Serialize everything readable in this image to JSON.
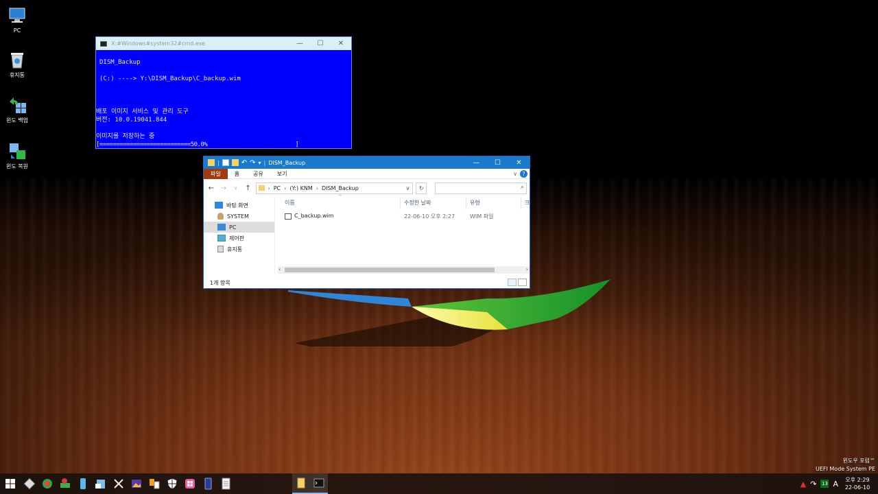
{
  "desktop": {
    "icons": [
      {
        "label": "PC",
        "icon": "pc-icon"
      },
      {
        "label": "휴지통",
        "icon": "recycle-bin-icon"
      },
      {
        "label": "윈도 백업",
        "icon": "windows-backup-icon"
      },
      {
        "label": "윈도 복원",
        "icon": "windows-restore-icon"
      }
    ],
    "brand_line1": "윈도우 포럼™",
    "brand_line2": "UEFI Mode System PE"
  },
  "cmd": {
    "title": "X:#Windows#system32#cmd.exe",
    "lines": [
      "DISM_Backup",
      "(C:) ----> Y:\\DISM_Backup\\C_backup.wim",
      "배포 이미지 서비스 및 관리 도구",
      "버전: 10.0.19041.844",
      "이미지를 저장하는 중",
      "[===========================50.0%                          ]"
    ],
    "progress_percent": 50.0
  },
  "explorer": {
    "title": "DISM_Backup",
    "ribbon_tabs": [
      "파일",
      "홈",
      "공유",
      "보기"
    ],
    "breadcrumb": [
      "PC",
      "(Y:) KNM",
      "DISM_Backup"
    ],
    "nav_items": [
      {
        "label": "바탕 화면",
        "icon": "desktop-icon"
      },
      {
        "label": "SYSTEM",
        "icon": "user-icon"
      },
      {
        "label": "PC",
        "icon": "pc-icon",
        "selected": true
      },
      {
        "label": "제어판",
        "icon": "control-panel-icon"
      },
      {
        "label": "휴지통",
        "icon": "recycle-bin-icon"
      }
    ],
    "columns": [
      "이름",
      "수정한 날짜",
      "유형",
      "크"
    ],
    "files": [
      {
        "name": "C_backup.wim",
        "modified": "22-06-10 오후 2:27",
        "type": "WIM 파일"
      }
    ],
    "status": "1개 항목"
  },
  "taskbar": {
    "pinned": [
      "start-icon",
      "settings-icon",
      "browser-icon",
      "drive-tools-icon",
      "disk-icon",
      "setup-icon",
      "tools-icon",
      "image-viewer-icon",
      "file-copy-icon",
      "shield-icon",
      "app-store-icon",
      "phone-icon",
      "notepad-icon"
    ],
    "running": [
      "file-explorer-icon",
      "cmd-icon"
    ],
    "tray_badge": "13",
    "lang": "A",
    "clock_time": "오후 2:29",
    "clock_date": "22-06-10"
  },
  "colors": {
    "cmd_bg": "#0000ff",
    "explorer_title": "#1979ca",
    "file_tab": "#a33b10"
  }
}
